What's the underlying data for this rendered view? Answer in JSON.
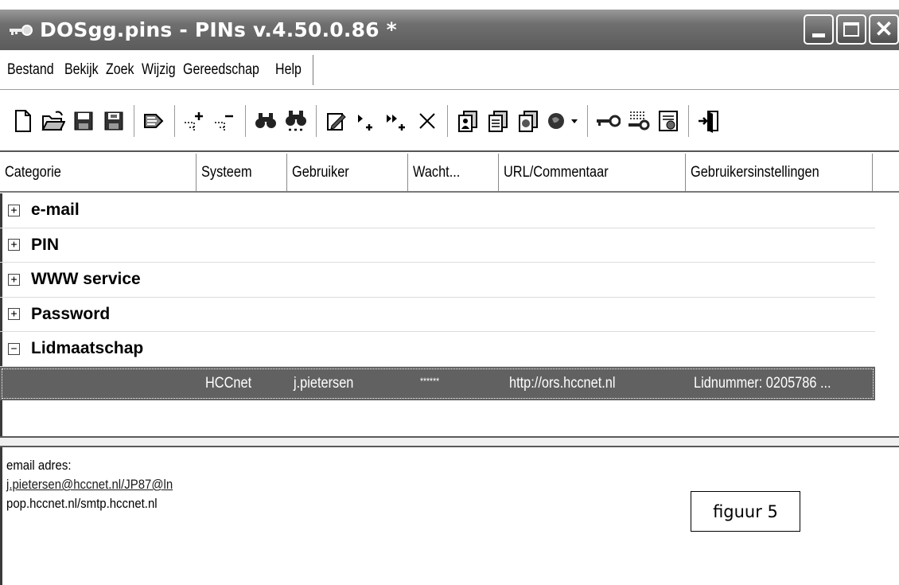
{
  "window": {
    "title": "DOSgg.pins - PINs v.4.50.0.86 *"
  },
  "menu": [
    "Bestand",
    "Bekijk",
    "Zoek",
    "Wijzig",
    "Gereedschap",
    "Help"
  ],
  "toolbar": {
    "buttons": [
      "new-file-icon",
      "open-folder-icon",
      "save-icon",
      "save-as-icon",
      "import-icon",
      "add-category-icon",
      "remove-category-icon",
      "find-icon",
      "find-next-icon",
      "edit-entry-icon",
      "add-entry-icon",
      "add-multiple-entries-icon",
      "delete-icon",
      "copy-user-icon",
      "copy-password-icon",
      "copy-url-icon",
      "browser-globe-icon",
      "key-icon",
      "password-generator-icon",
      "settings-icon",
      "exit-icon"
    ]
  },
  "columns": [
    "Categorie",
    "Systeem",
    "Gebruiker",
    "Wacht...",
    "URL/Commentaar",
    "Gebruikersinstellingen"
  ],
  "categories": [
    {
      "expander": "+",
      "name": "e-mail"
    },
    {
      "expander": "+",
      "name": "PIN"
    },
    {
      "expander": "+",
      "name": "WWW service"
    },
    {
      "expander": "+",
      "name": "Password"
    },
    {
      "expander": "−",
      "name": "Lidmaatschap"
    }
  ],
  "selected_entry": {
    "systeem": "HCCnet",
    "gebruiker": "j.pietersen",
    "wachtwoord": "******",
    "url": "http://ors.hccnet.nl",
    "instellingen": "Lidnummer: 0205786  ..."
  },
  "detail": {
    "line1": "email adres:",
    "line2": "j.pietersen@hccnet.nl/JP87@ln",
    "line3": "pop.hccnet.nl/smtp.hccnet.nl"
  },
  "figure_label": "figuur 5",
  "colors": {
    "titlebar": "#6f6f6f",
    "selection": "#616161"
  }
}
